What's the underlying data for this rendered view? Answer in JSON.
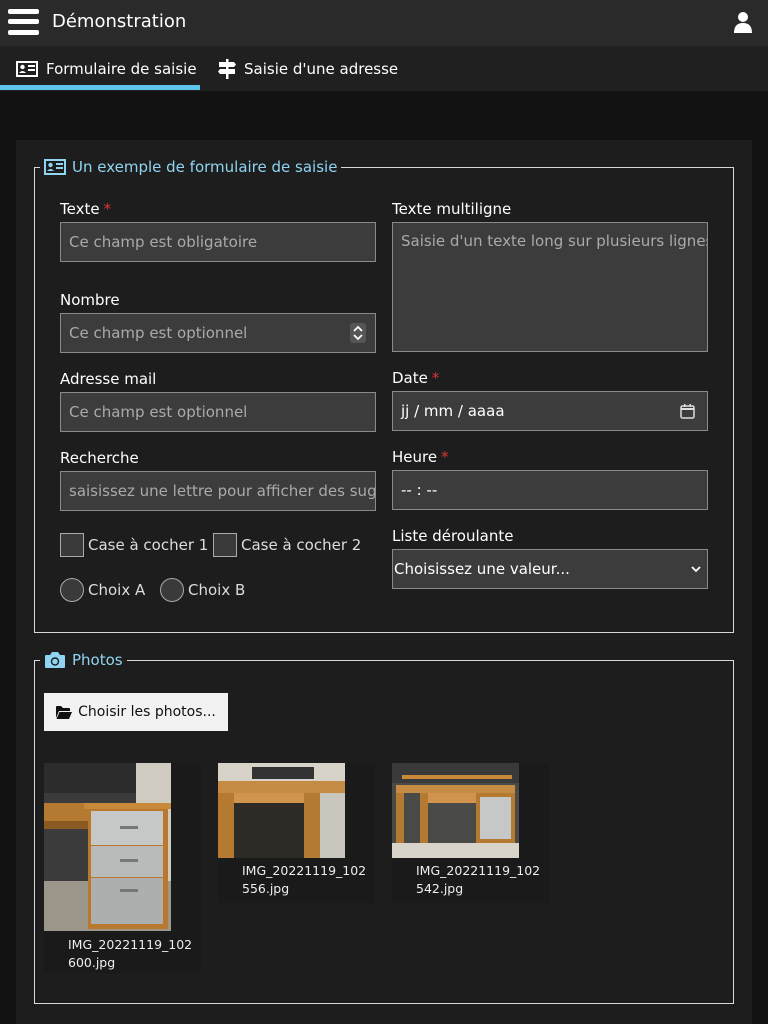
{
  "header": {
    "title": "Démonstration"
  },
  "tabs": [
    {
      "label": "Formulaire de saisie",
      "active": true
    },
    {
      "label": "Saisie d'une adresse",
      "active": false
    }
  ],
  "form": {
    "legend": "Un exemple de formulaire de saisie",
    "text": {
      "label": "Texte",
      "required_mark": "*",
      "placeholder": "Ce champ est obligatoire"
    },
    "multiline": {
      "label": "Texte multiligne",
      "placeholder": "Saisie d'un texte long sur plusieurs lignes..."
    },
    "number": {
      "label": "Nombre",
      "placeholder": "Ce champ est optionnel"
    },
    "date": {
      "label": "Date",
      "required_mark": "*",
      "placeholder": "jj / mm / aaaa"
    },
    "email": {
      "label": "Adresse mail",
      "placeholder": "Ce champ est optionnel"
    },
    "time": {
      "label": "Heure",
      "required_mark": "*",
      "placeholder": "-- : --"
    },
    "search": {
      "label": "Recherche",
      "placeholder": "saisissez une lettre pour afficher des suggestions"
    },
    "select": {
      "label": "Liste déroulante",
      "value": "Choisissez une valeur..."
    },
    "checkboxes": [
      {
        "label": "Case à cocher 1"
      },
      {
        "label": "Case à cocher 2"
      }
    ],
    "radios": [
      {
        "label": "Choix A"
      },
      {
        "label": "Choix B"
      }
    ]
  },
  "photos": {
    "legend": "Photos",
    "button_label": "Choisir les photos...",
    "items": [
      {
        "line1": "IMG_20221119_102",
        "line2": "600.jpg"
      },
      {
        "line1": "IMG_20221119_102",
        "line2": "556.jpg"
      },
      {
        "line1": "IMG_20221119_102",
        "line2": "542.jpg"
      }
    ]
  }
}
